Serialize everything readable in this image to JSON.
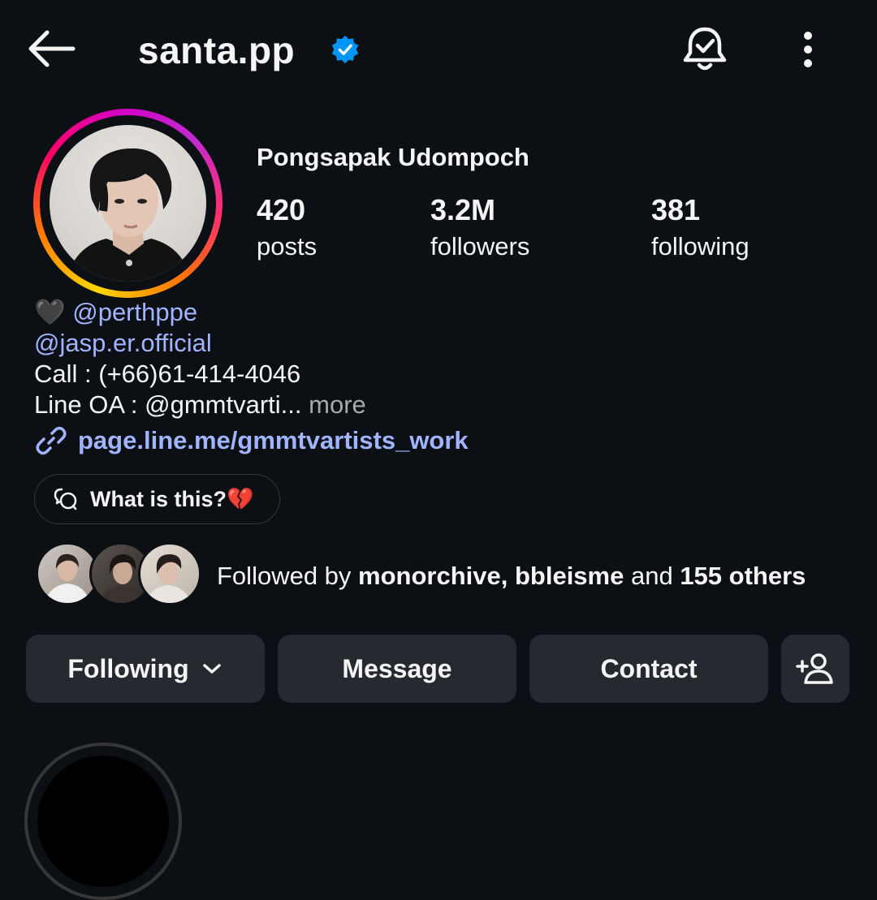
{
  "header": {
    "username": "santa.pp",
    "icons": [
      "arrow-left-icon",
      "verified-badge-icon",
      "bell-check-icon",
      "more-vertical-icon"
    ]
  },
  "profile": {
    "full_name": "Pongsapak Udompoch",
    "stats": [
      {
        "value": "420",
        "label": "posts"
      },
      {
        "value": "3.2M",
        "label": "followers"
      },
      {
        "value": "381",
        "label": "following"
      }
    ]
  },
  "bio": {
    "line1_emoji": "🖤",
    "line1_mention": "@perthppe",
    "line2_mention": "@jasp.er.official",
    "line3": "Call : (+66)61-414-4046",
    "line4": "Line OA : @gmmtvarti...",
    "more_label": "more",
    "link": "page.line.me/gmmtvartists_work"
  },
  "note_pill": {
    "label": "What is this?💔"
  },
  "mutual": {
    "prefix": "Followed by ",
    "names": "monorchive, bbleisme",
    "middle": " and ",
    "others": "155 others"
  },
  "actions": {
    "following_label": "Following",
    "message_label": "Message",
    "contact_label": "Contact"
  },
  "colors": {
    "background": "#0c1014",
    "link": "#a0b4ff",
    "button_bg": "#262a30",
    "verified": "#0095f6"
  }
}
